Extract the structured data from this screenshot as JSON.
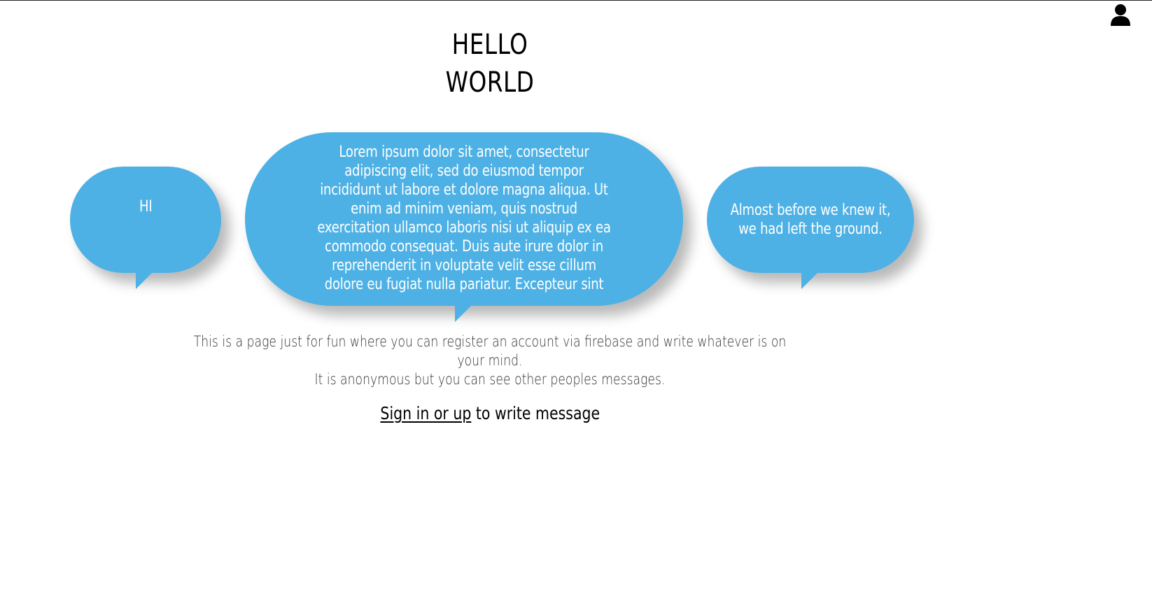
{
  "header": {
    "user_icon": "user-icon"
  },
  "title": {
    "line1": "HELLO",
    "line2": "WORLD"
  },
  "bubbles": [
    {
      "text": "HI"
    },
    {
      "text": "Lorem ipsum dolor sit amet, consectetur adipiscing elit, sed do eiusmod tempor incididunt ut labore et dolore magna aliqua. Ut enim ad minim veniam, quis nostrud exercitation ullamco laboris nisi ut aliquip ex ea commodo consequat. Duis aute irure dolor in reprehenderit in voluptate velit esse cillum dolore eu fugiat nulla pariatur. Excepteur sint"
    },
    {
      "text": "Almost before we knew it, we had left the ground."
    }
  ],
  "description": {
    "line1": "This is a page just for fun where you can register an account via firebase and write whatever is on your mind.",
    "line2": "It is anonymous but you can see other peoples messages."
  },
  "signin": {
    "link_text": "Sign in or up",
    "suffix_text": " to write message"
  },
  "colors": {
    "bubble": "#4eb1e5",
    "text": "#000000"
  }
}
